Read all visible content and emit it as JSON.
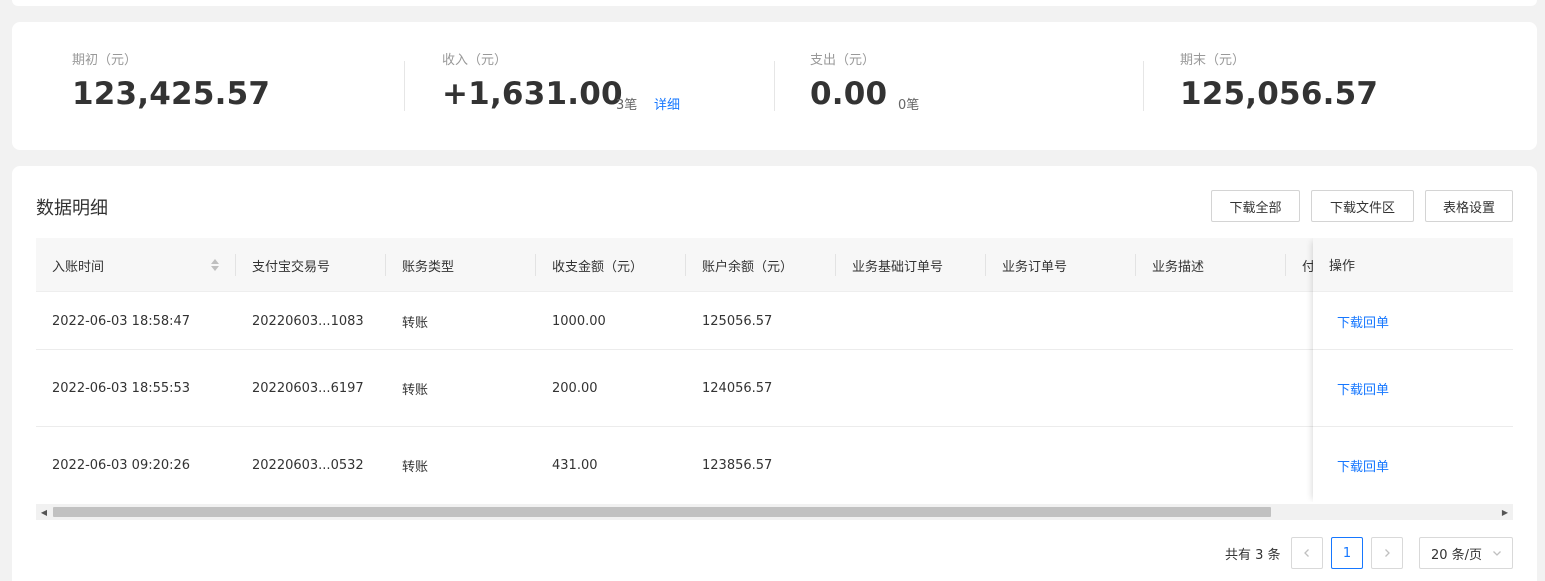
{
  "summary": {
    "opening": {
      "label": "期初（元）",
      "value": "123,425.57"
    },
    "income": {
      "label": "收入（元）",
      "value": "+1,631.00",
      "count": "3笔",
      "detail_link": "详细"
    },
    "expense": {
      "label": "支出（元）",
      "value": "0.00",
      "count": "0笔"
    },
    "closing": {
      "label": "期末（元）",
      "value": "125,056.57"
    }
  },
  "detail": {
    "title": "数据明细",
    "buttons": {
      "download_all": "下载全部",
      "download_files": "下载文件区",
      "table_settings": "表格设置"
    }
  },
  "table": {
    "columns": [
      "入账时间",
      "支付宝交易号",
      "账务类型",
      "收支金额（元）",
      "账户余额（元）",
      "业务基础订单号",
      "业务订单号",
      "业务描述",
      "付"
    ],
    "op_header": "操作",
    "rows": [
      {
        "time": "2022-06-03 18:58:47",
        "trade_no": "20220603...1083",
        "type": "转账",
        "amount": "1000.00",
        "balance": "125056.57",
        "op": "下载回单"
      },
      {
        "time": "2022-06-03 18:55:53",
        "trade_no": "20220603...6197",
        "type": "转账",
        "amount": "200.00",
        "balance": "124056.57",
        "op": "下载回单"
      },
      {
        "time": "2022-06-03 09:20:26",
        "trade_no": "20220603...0532",
        "type": "转账",
        "amount": "431.00",
        "balance": "123856.57",
        "op": "下载回单"
      }
    ]
  },
  "pagination": {
    "total": "共有 3 条",
    "current_page": "1",
    "page_size": "20 条/页",
    "prev_icon": "chevron-left-icon",
    "next_icon": "chevron-right-icon"
  },
  "colors": {
    "link": "#1677ff",
    "text": "#333333",
    "muted": "#999999"
  }
}
